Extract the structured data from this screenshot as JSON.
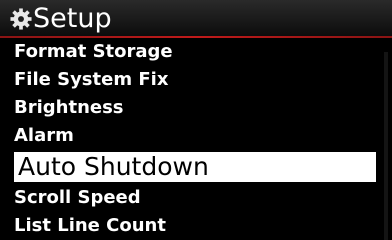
{
  "header": {
    "icon": "gear-icon",
    "title": "Setup",
    "accent_color": "#c01a1a"
  },
  "menu": {
    "items": [
      {
        "label": "Format Storage"
      },
      {
        "label": "File System Fix"
      },
      {
        "label": "Brightness"
      },
      {
        "label": "Alarm"
      },
      {
        "label": "Auto Shutdown",
        "selected": true
      },
      {
        "label": "Scroll Speed"
      },
      {
        "label": "List Line Count"
      }
    ]
  }
}
